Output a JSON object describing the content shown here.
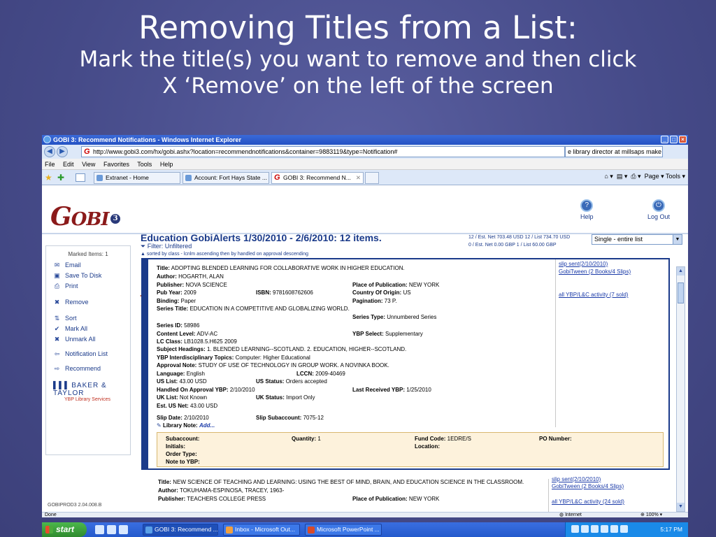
{
  "slide": {
    "title": "Removing Titles from a List:",
    "subtitle_line1": "Mark the title(s) you want to remove and then click",
    "subtitle_line2": "X ‘Remove’ on the left of the screen"
  },
  "window": {
    "title": "GOBI 3: Recommend Notifications - Windows Internet Explorer",
    "url": "http://www.gobi3.com/hx/gobi.ashx?location=recommendnotifications&container=9883119&type=Notification#",
    "search_value": "e library director at millsaps make",
    "menu": [
      "File",
      "Edit",
      "View",
      "Favorites",
      "Tools",
      "Help"
    ],
    "tabs": [
      "Extranet - Home",
      "Account: Fort Hays State ...",
      "GOBI 3: Recommend N..."
    ],
    "toolbar_right": "Page ▾  Tools ▾",
    "status_left": "Done",
    "status_zone": "Internet",
    "status_zoom": "100%"
  },
  "gobi": {
    "logo_main": "G",
    "logo_rest": "OBI",
    "logo_num": "3",
    "help_label": "Help",
    "logout_label": "Log Out",
    "heading": "Education GobiAlerts 1/30/2010 - 2/6/2010: 12 items.",
    "filter": "Filter: Unfiltered",
    "sorted": "sorted by class - lcnlm ascending then by handled on approval descending",
    "stats_line1": "12 / Est. Net 703.48 USD  12 / List 734.70 USD",
    "stats_line2": "0 / Est. Net 0.00 GBP     1 / List 60.00 GBP",
    "view_select": "Single - entire list",
    "build": "GOBIPROD3 2.04.008.B"
  },
  "sidebar": {
    "marked": "Marked Items: 1",
    "items": [
      {
        "label": "Email"
      },
      {
        "label": "Save To Disk"
      },
      {
        "label": "Print"
      },
      {
        "label": "Remove"
      },
      {
        "label": "Sort"
      },
      {
        "label": "Mark All"
      },
      {
        "label": "Unmark All"
      },
      {
        "label": "Notification List"
      },
      {
        "label": "Recommend"
      }
    ],
    "bt_name": "BAKER & TAYLOR",
    "bt_sub": "YBP Library Services"
  },
  "record1": {
    "title_label": "Title:",
    "title": "ADOPTING BLENDED LEARNING FOR COLLABORATIVE WORK IN HIGHER EDUCATION.",
    "author_label": "Author:",
    "author": "HOGARTH, ALAN",
    "publisher_label": "Publisher:",
    "publisher": "NOVA SCIENCE",
    "pop_label": "Place of Publication:",
    "pop": "NEW YORK",
    "pubyear_label": "Pub Year:",
    "pubyear": "2009",
    "isbn_label": "ISBN:",
    "isbn": "9781608762606",
    "country_label": "Country Of Origin:",
    "country": "US",
    "binding_label": "Binding:",
    "binding": "Paper",
    "pagination_label": "Pagination:",
    "pagination": "73 P.",
    "series_label": "Series Title:",
    "series": "EDUCATION IN A COMPETITIVE AND GLOBALIZING WORLD.",
    "seriestype_label": "Series Type:",
    "seriestype": "Unnumbered Series",
    "seriesid_label": "Series ID:",
    "seriesid": "58986",
    "content_label": "Content Level:",
    "content": "ADV-AC",
    "ybpselect_label": "YBP Select:",
    "ybpselect": "Supplementary",
    "lcclass_label": "LC Class:",
    "lcclass": "LB1028.5.H625 2009",
    "subject_label": "Subject Headings:",
    "subject": "1. BLENDED LEARNING--SCOTLAND. 2. EDUCATION, HIGHER--SCOTLAND.",
    "ybpinter_label": "YBP Interdisciplinary Topics:",
    "ybpinter": "Computer: Higher Educational",
    "approval_label": "Approval Note:",
    "approval": "STUDY OF USE OF TECHNOLOGY IN GROUP WORK. A NOVINKA BOOK.",
    "language_label": "Language:",
    "language": "English",
    "lccn_label": "LCCN:",
    "lccn": "2009-40469",
    "uslist_label": "US List:",
    "uslist": "43.00 USD",
    "usstatus_label": "US Status:",
    "usstatus": "Orders accepted",
    "handled_label": "Handled On Approval YBP:",
    "handled": "2/10/2010",
    "lastrec_label": "Last Received YBP:",
    "lastrec": "1/25/2010",
    "uklist_label": "UK List:",
    "uklist": "Not Known",
    "ukstatus_label": "UK Status:",
    "ukstatus": "Import Only",
    "estnet_label": "Est. US Net:",
    "estnet": "43.00 USD",
    "slipdate_label": "Slip Date:",
    "slipdate": "2/10/2010",
    "slipsub_label": "Slip Subaccount:",
    "slipsub": "7075-12",
    "libnote_label": "Library Note:",
    "libnote": "Add...",
    "link1": "slip sent(2/10/2010)",
    "link2": "GobiTween (2 Books/4 Slips)",
    "link3": "all YBP/L&C activity (7 sold)",
    "order": {
      "subaccount": "Subaccount:",
      "quantity_label": "Quantity:",
      "quantity": "1",
      "fund_label": "Fund Code:",
      "fund": "1EDRE/S",
      "po": "PO Number:",
      "initials": "Initials:",
      "location": "Location:",
      "ordertype": "Order Type:",
      "note": "Note to YBP:"
    }
  },
  "record2": {
    "title_label": "Title:",
    "title": "NEW SCIENCE OF TEACHING AND LEARNING: USING THE BEST OF MIND, BRAIN, AND EDUCATION SCIENCE IN THE CLASSROOM.",
    "author_label": "Author:",
    "author": "TOKUHAMA-ESPINOSA, TRACEY, 1963-",
    "publisher_label": "Publisher:",
    "publisher": "TEACHERS COLLEGE PRESS",
    "pop_label": "Place of Publication:",
    "pop": "NEW YORK",
    "link1": "slip sent(2/10/2010)",
    "link2": "GobiTween (2 Books/4 Slips)",
    "link3": "all YBP/L&C activity (24 sold)"
  },
  "taskbar": {
    "start": "start",
    "tasks": [
      "GOBI 3: Recommend ...",
      "Inbox - Microsoft Out...",
      "Microsoft PowerPoint ..."
    ],
    "clock": "5:17 PM"
  },
  "colors": {
    "slide_bg": "#4a4f8e",
    "gobi_blue": "#1a3a8a",
    "arrow": "#e8602a",
    "order_bg": "#fdf2dc"
  }
}
